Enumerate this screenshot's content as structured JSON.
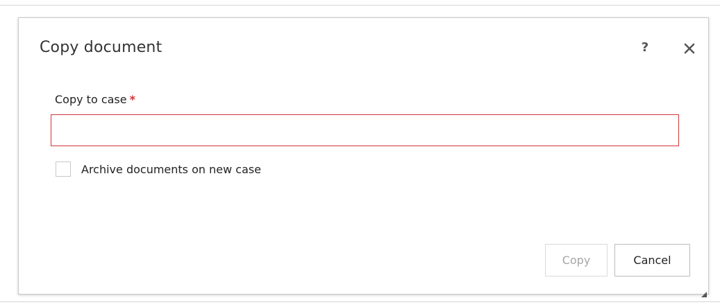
{
  "dialog": {
    "title": "Copy document",
    "help_icon": "help-icon",
    "help_glyph": "?",
    "close_icon": "close-icon"
  },
  "form": {
    "case_field": {
      "label": "Copy to case",
      "required_marker": "*",
      "value": "",
      "placeholder": ""
    },
    "archive_checkbox": {
      "label": "Archive documents on new case",
      "checked": false
    }
  },
  "buttons": {
    "copy_label": "Copy",
    "cancel_label": "Cancel"
  },
  "colors": {
    "required": "#d13438",
    "input_error_border": "#d13438",
    "disabled_text": "#a6a6a6",
    "text": "#222222"
  }
}
